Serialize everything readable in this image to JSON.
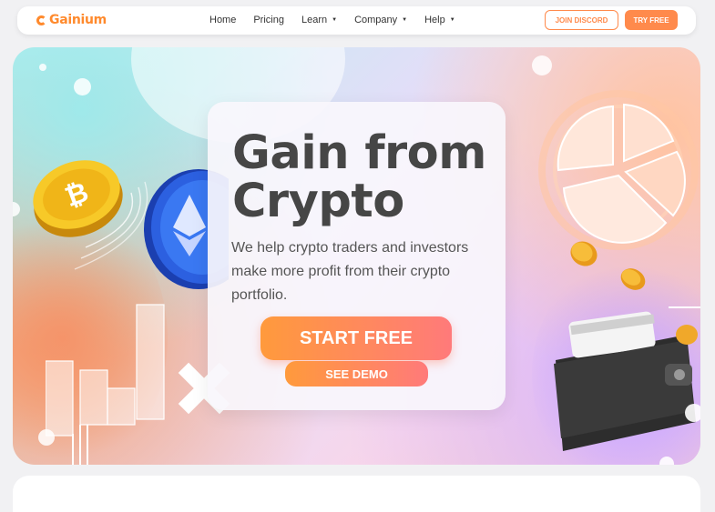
{
  "brand": {
    "name": "Gainium",
    "logo_icon": "gainium-logo-icon",
    "accent": "#ff8a4c"
  },
  "nav": {
    "items": [
      {
        "label": "Home",
        "has_dropdown": false
      },
      {
        "label": "Pricing",
        "has_dropdown": false
      },
      {
        "label": "Learn",
        "has_dropdown": true
      },
      {
        "label": "Company",
        "has_dropdown": true
      },
      {
        "label": "Help",
        "has_dropdown": true
      }
    ],
    "dropdown_glyph": "▼",
    "discord_label": "JOIN DISCORD",
    "try_label": "TRY FREE"
  },
  "hero": {
    "title_line1": "Gain from",
    "title_line2": "Crypto",
    "subtitle": "We help crypto traders and investors make more profit from their crypto portfolio.",
    "start_label": "START FREE",
    "demo_label": "SEE DEMO",
    "illustrations": [
      "bitcoin-coin-icon",
      "ethereum-coin-icon",
      "glass-bar-chart",
      "pie-chart",
      "gold-coins",
      "wallet-icon"
    ]
  }
}
